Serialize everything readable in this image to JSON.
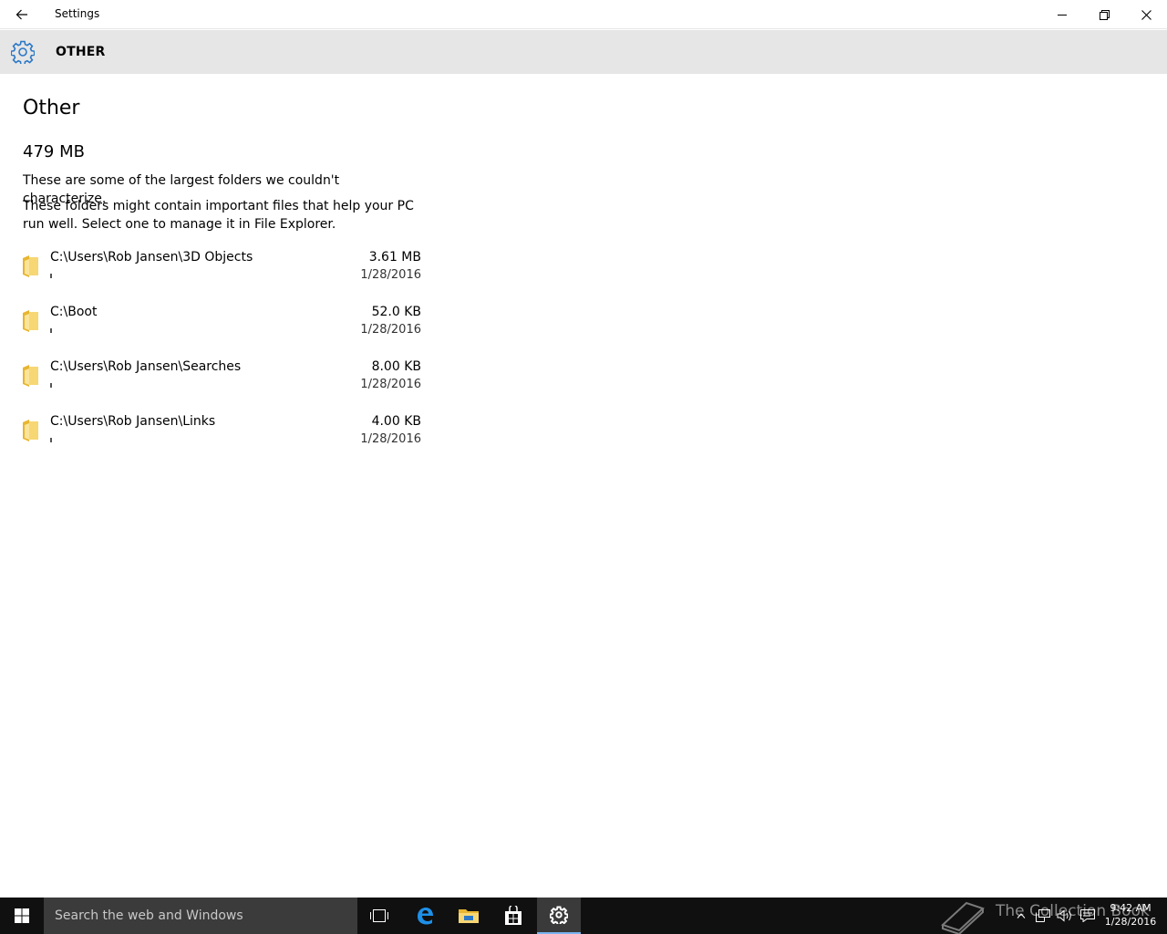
{
  "window": {
    "title": "Settings"
  },
  "header": {
    "title": "OTHER",
    "icon": "gear-icon",
    "accent": "#2b78c6"
  },
  "main": {
    "page_title": "Other",
    "total_size": "479 MB",
    "description_1": "These are some of the largest folders we couldn't characterize.",
    "description_2": "These folders might contain important files that help your PC run well. Select one to manage it in File Explorer.",
    "folders": [
      {
        "path": "C:\\Users\\Rob Jansen\\3D Objects",
        "size": "3.61 MB",
        "date": "1/28/2016",
        "usage_fraction": 0.008
      },
      {
        "path": "C:\\Boot",
        "size": "52.0 KB",
        "date": "1/28/2016",
        "usage_fraction": 0.001
      },
      {
        "path": "C:\\Users\\Rob Jansen\\Searches",
        "size": "8.00 KB",
        "date": "1/28/2016",
        "usage_fraction": 0.001
      },
      {
        "path": "C:\\Users\\Rob Jansen\\Links",
        "size": "4.00 KB",
        "date": "1/28/2016",
        "usage_fraction": 0.001
      }
    ],
    "folder_icon_color": "#f2c94c"
  },
  "taskbar": {
    "search_placeholder": "Search the web and Windows",
    "apps": [
      "task-view-icon",
      "edge-icon",
      "file-explorer-icon",
      "store-icon",
      "settings-icon"
    ],
    "active_app": "settings-icon",
    "watermark": "The Collection Book",
    "clock_time": "9:42 AM",
    "clock_date": "1/28/2016"
  }
}
